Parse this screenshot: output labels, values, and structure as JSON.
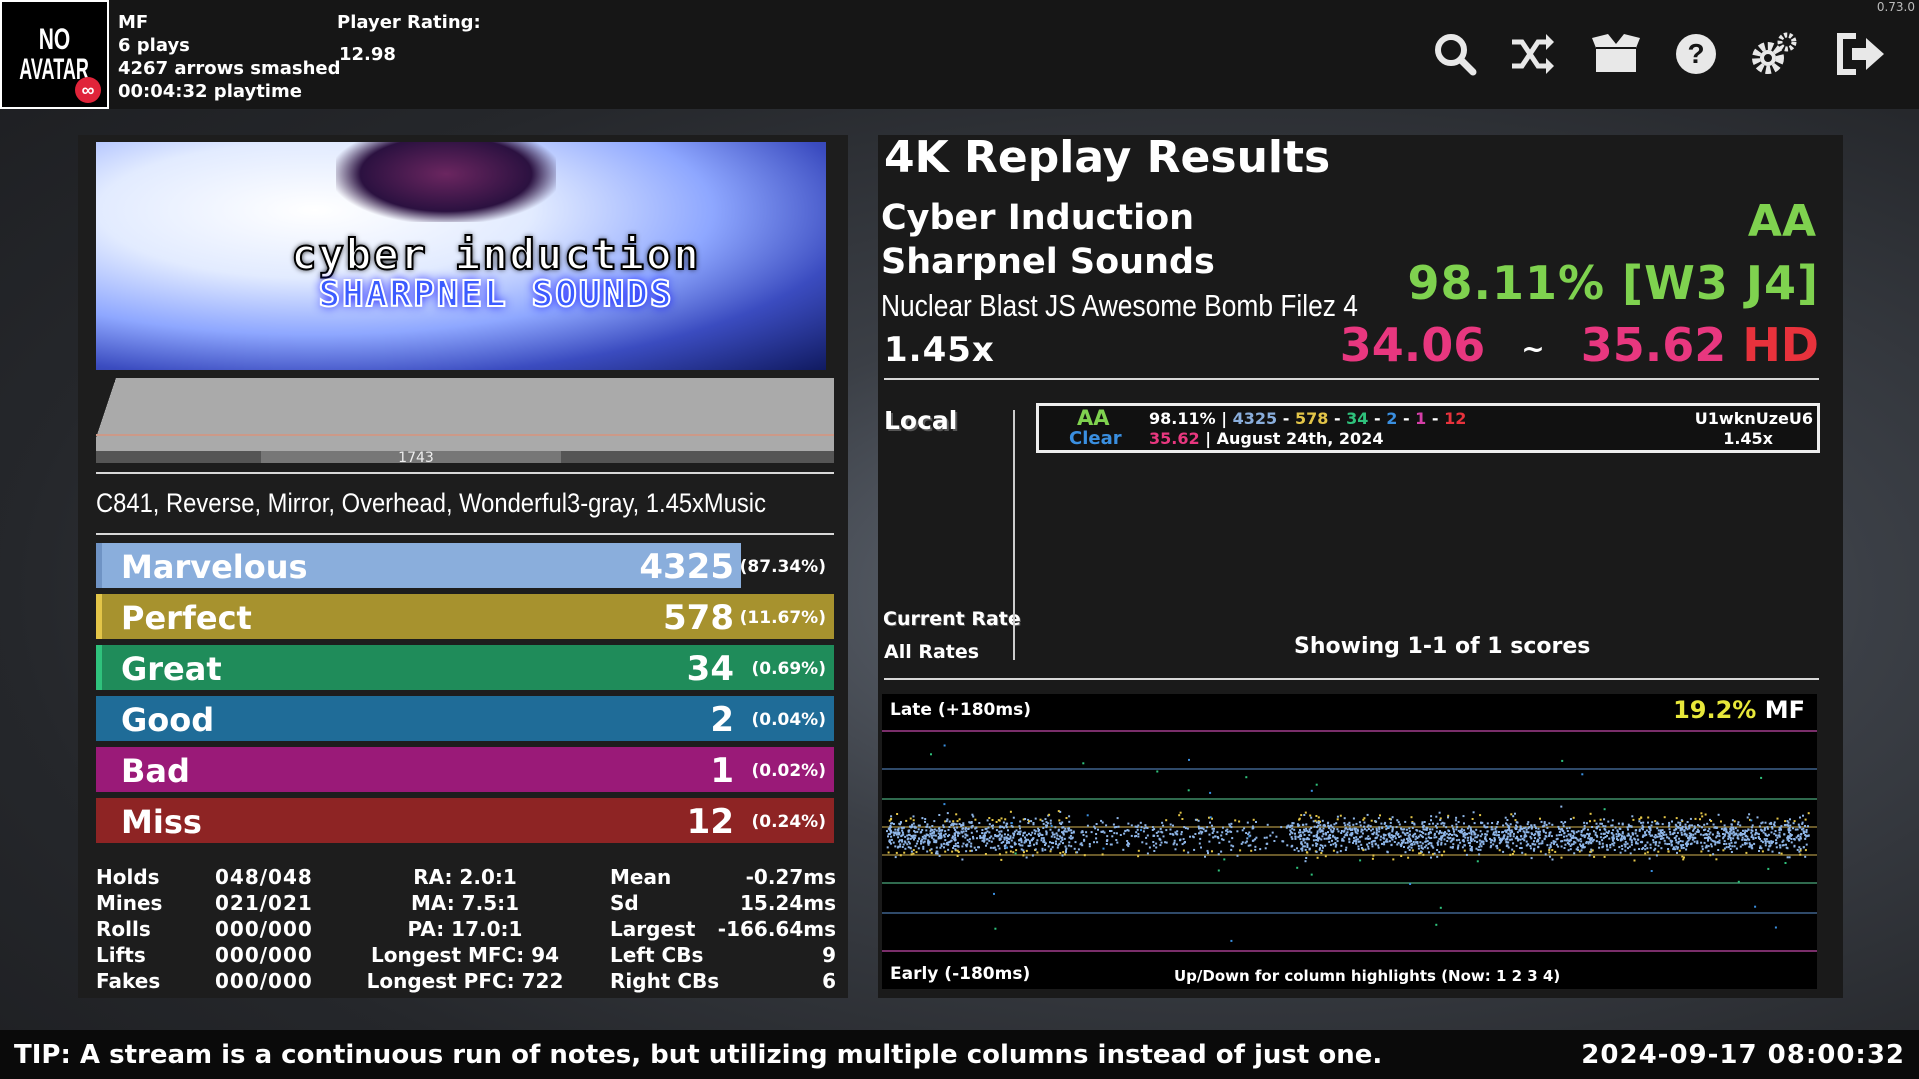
{
  "version": "0.73.0",
  "player": {
    "avatar_line1": "NO",
    "avatar_line2": "AVATAR",
    "name": "MF",
    "plays": "6 plays",
    "arrows": "4267 arrows smashed",
    "playtime": "00:04:32 playtime",
    "rating_label": "Player Rating:",
    "rating_value": "12.98"
  },
  "toolbar_icons": [
    "search-icon",
    "shuffle-icon",
    "package-icon",
    "help-icon",
    "settings-icon",
    "exit-icon"
  ],
  "song": {
    "banner_title": "cyber induction",
    "banner_artist": "SHARPNEL SOUNDS",
    "note_count": "1743",
    "mods": "C841, Reverse, Mirror, Overhead, Wonderful3-gray, 1.45xMusic"
  },
  "judgments": [
    {
      "name": "Marvelous",
      "count": "4325",
      "pct": "(87.34%)",
      "fraction": 0.8734,
      "color": "#8aaedc",
      "stripe": "#6f93c4"
    },
    {
      "name": "Perfect",
      "count": "578",
      "pct": "(11.67%)",
      "fraction": 1.0,
      "color": "#a7922e",
      "stripe": "#e3c548"
    },
    {
      "name": "Great",
      "count": "34",
      "pct": "(0.69%)",
      "fraction": 1.0,
      "color": "#1f8c5a",
      "stripe": "#2fc27c"
    },
    {
      "name": "Good",
      "count": "2",
      "pct": "(0.04%)",
      "fraction": 1.0,
      "color": "#1f6c98",
      "stripe": "#1f6c98"
    },
    {
      "name": "Bad",
      "count": "1",
      "pct": "(0.02%)",
      "fraction": 1.0,
      "color": "#9a1a78",
      "stripe": "#9a1a78"
    },
    {
      "name": "Miss",
      "count": "12",
      "pct": "(0.24%)",
      "fraction": 1.0,
      "color": "#8e2424",
      "stripe": "#8e2424"
    }
  ],
  "stats": {
    "holds": {
      "label": "Holds",
      "value": "048/048"
    },
    "mines": {
      "label": "Mines",
      "value": "021/021"
    },
    "rolls": {
      "label": "Rolls",
      "value": "000/000"
    },
    "lifts": {
      "label": "Lifts",
      "value": "000/000"
    },
    "fakes": {
      "label": "Fakes",
      "value": "000/000"
    },
    "ra": "RA: 2.0:1",
    "ma": "MA: 7.5:1",
    "pa": "PA: 17.0:1",
    "mfc": "Longest MFC: 94",
    "pfc": "Longest PFC: 722",
    "mean": {
      "label": "Mean",
      "value": "-0.27ms"
    },
    "sd": {
      "label": "Sd",
      "value": "15.24ms"
    },
    "largest": {
      "label": "Largest",
      "value": "-166.64ms"
    },
    "left_cbs": {
      "label": "Left CBs",
      "value": "9"
    },
    "right_cbs": {
      "label": "Right CBs",
      "value": "6"
    }
  },
  "results": {
    "title": "4K Replay Results",
    "song_title": "Cyber Induction",
    "artist": "Sharpnel Sounds",
    "pack": "Nuclear Blast JS Awesome Bomb Filez 4",
    "rate": "1.45x",
    "grade": "AA",
    "wife": "98.11% [W3 J4]",
    "msd": "34.06",
    "tilde": "~",
    "ssr": "35.62",
    "difficulty": "HD",
    "colors": {
      "grade": "#7fd24f",
      "msd": "#e8377f",
      "difficulty": "#e8323c"
    }
  },
  "scoreboard": {
    "tab_local": "Local",
    "tab_current_rate": "Current Rate",
    "tab_all_rates": "All Rates",
    "showing": "Showing 1-1 of 1 scores",
    "entry": {
      "grade": "AA",
      "clear": "Clear",
      "wife": "98.11%",
      "pipe": "|",
      "marv": "4325",
      "perf": "578",
      "great": "34",
      "good": "2",
      "bad": "1",
      "miss": "12",
      "ssr": "35.62",
      "date": "| August 24th, 2024",
      "user": "U1wknUzeU6",
      "rate": "1.45x"
    }
  },
  "offset_plot": {
    "late_label": "Late (+180ms)",
    "early_label": "Early (-180ms)",
    "mf_pct": "19.2%",
    "mf_label": "MF",
    "hint": "Up/Down for column highlights (Now: 1 2 3 4)"
  },
  "footer": {
    "tip": "TIP: A stream is a continuous run of notes, but utilizing multiple columns instead of just one.",
    "clock": "2024-09-17 08:00:32"
  }
}
